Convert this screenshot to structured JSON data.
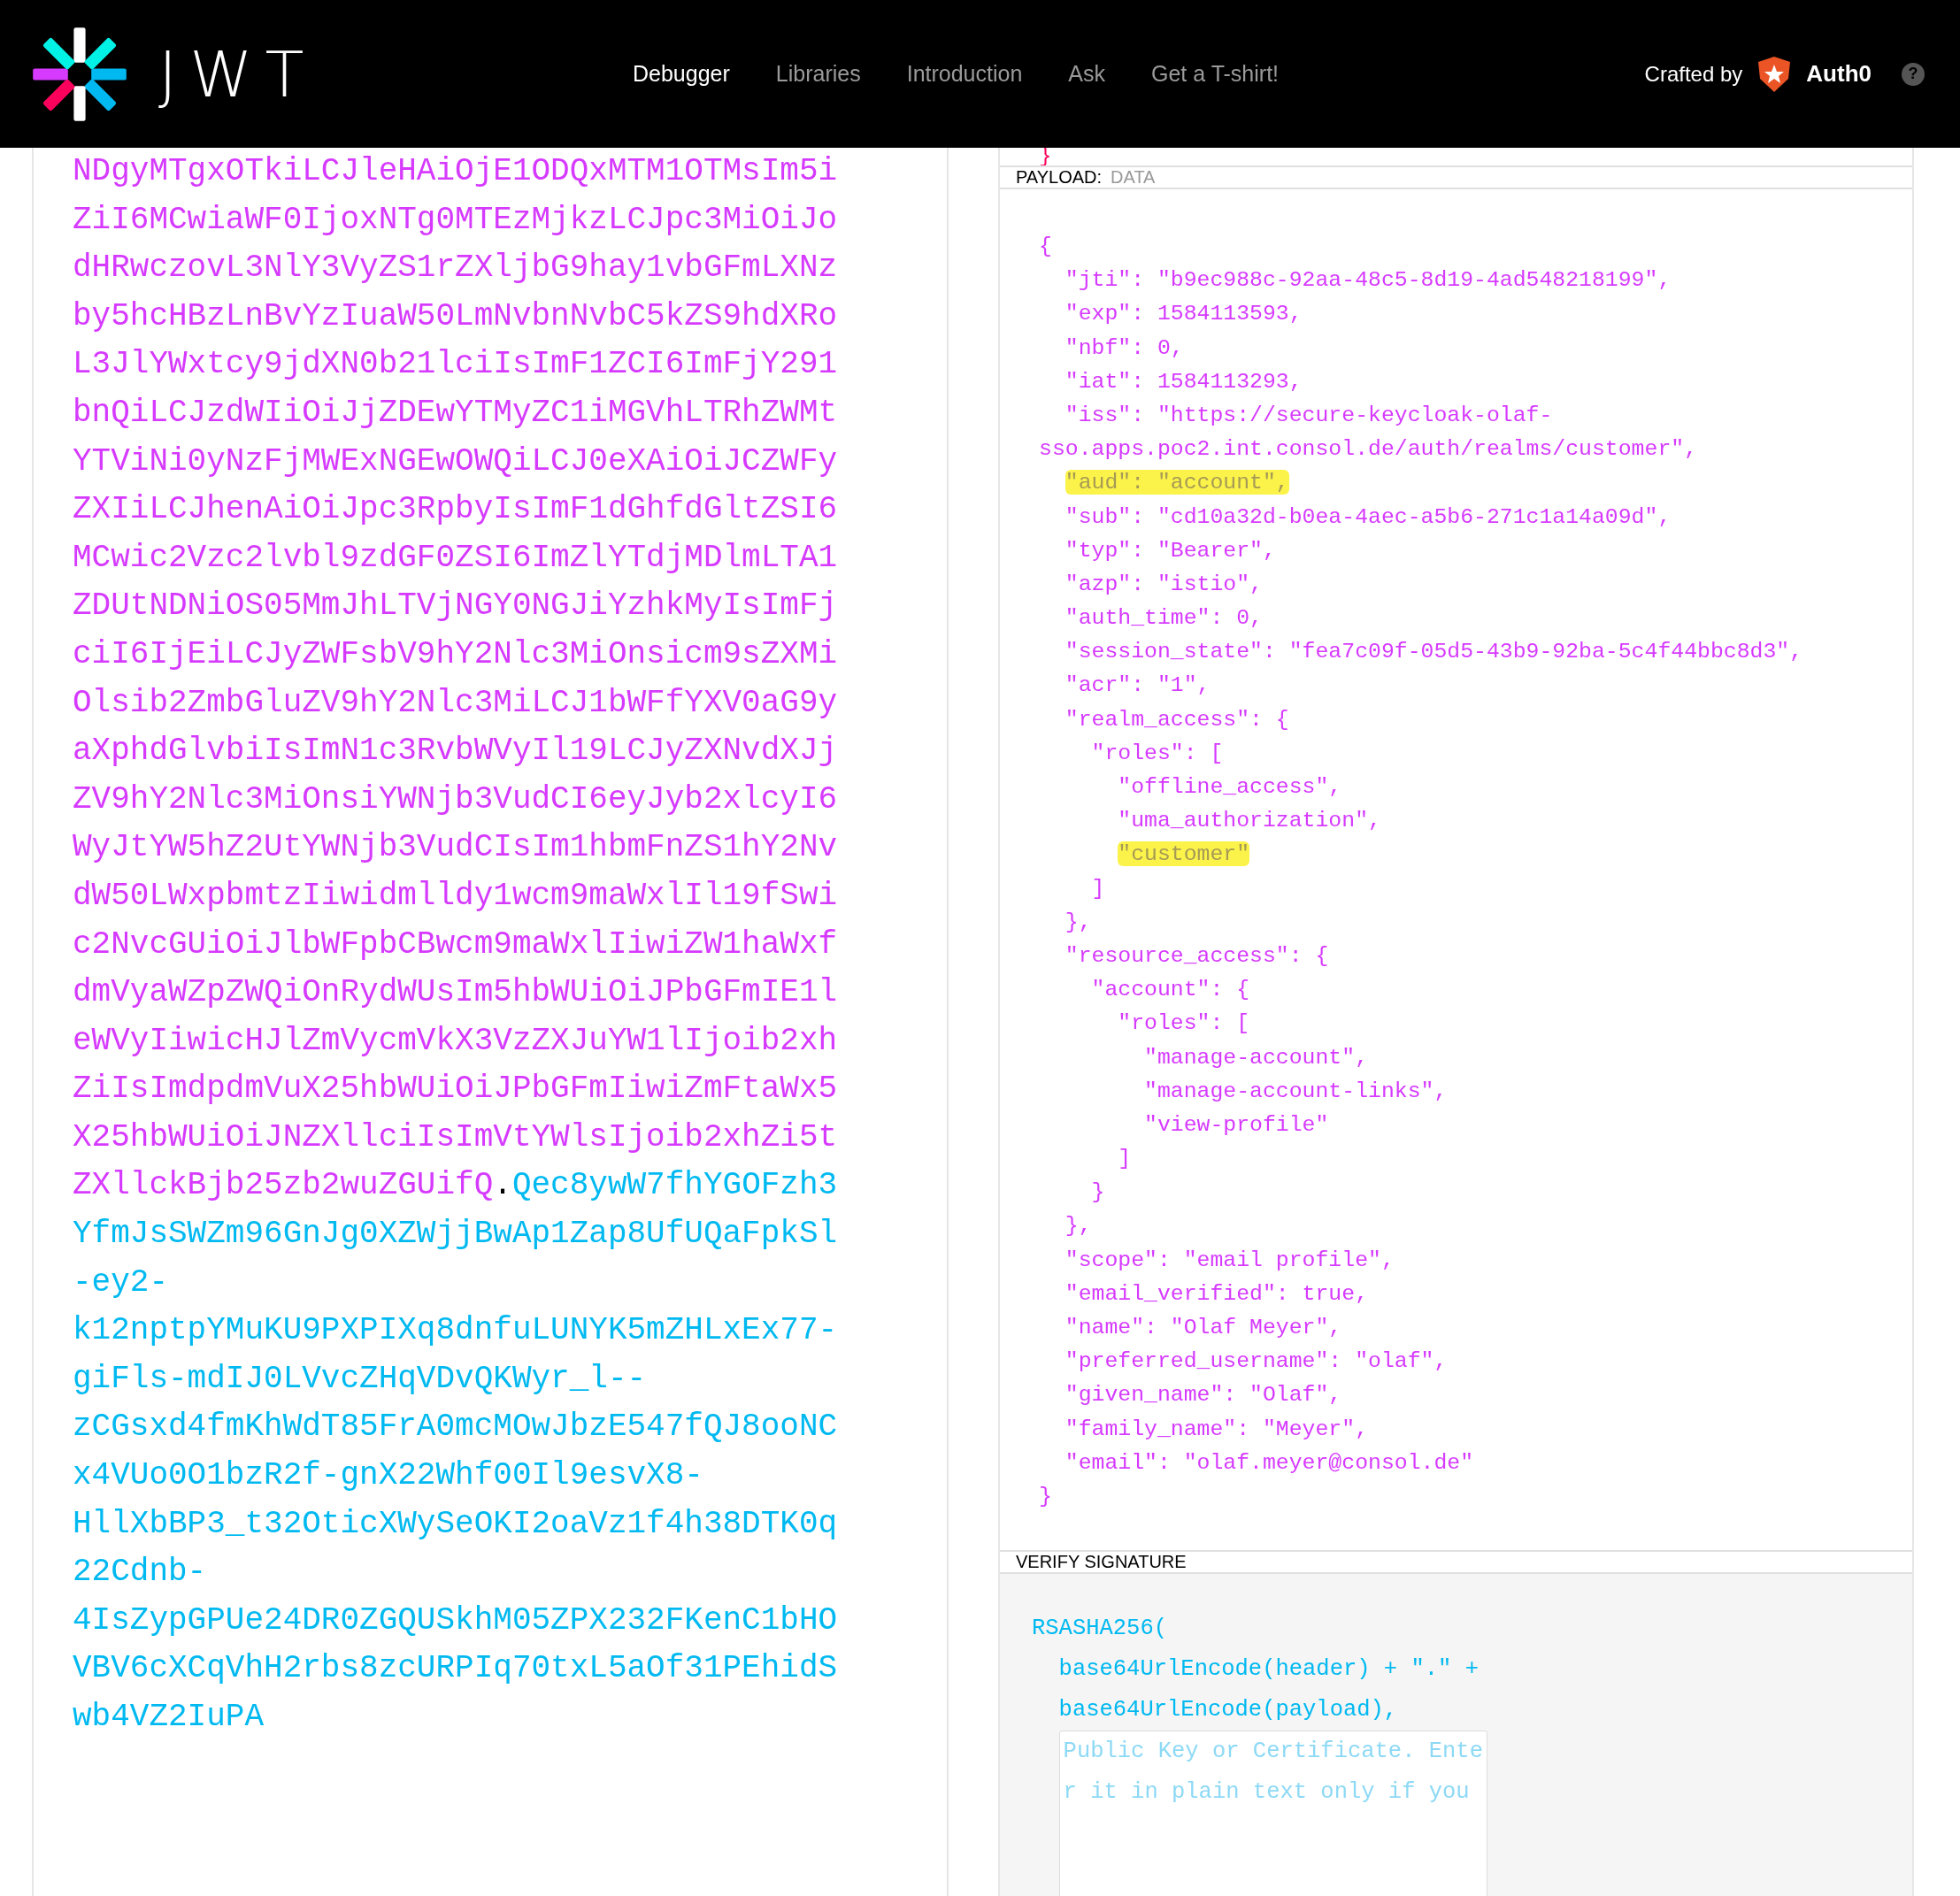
{
  "nav": {
    "logo_text": "JWT",
    "items": [
      {
        "label": "Debugger",
        "selected": true
      },
      {
        "label": "Libraries",
        "selected": false
      },
      {
        "label": "Introduction",
        "selected": false
      },
      {
        "label": "Ask",
        "selected": false
      },
      {
        "label": "Get a T-shirt!",
        "selected": false
      }
    ],
    "credit": "Crafted by",
    "brand": "Auth0",
    "help": "?"
  },
  "encoded": {
    "lines": [
      {
        "segments": [
          {
            "kind": "payload",
            "text": "NDgyMTgxOTkiLCJleHAiOjE1ODQxMTM1OTMsIm5i"
          }
        ]
      },
      {
        "segments": [
          {
            "kind": "payload",
            "text": "ZiI6MCwiaWF0IjoxNTg0MTEzMjkzLCJpc3MiOiJo"
          }
        ]
      },
      {
        "segments": [
          {
            "kind": "payload",
            "text": "dHRwczovL3NlY3VyZS1rZXljbG9hay1vbGFmLXNz"
          }
        ]
      },
      {
        "segments": [
          {
            "kind": "payload",
            "text": "by5hcHBzLnBvYzIuaW50LmNvbnNvbC5kZS9hdXRo"
          }
        ]
      },
      {
        "segments": [
          {
            "kind": "payload",
            "text": "L3JlYWxtcy9jdXN0b21lciIsImF1ZCI6ImFjY291"
          }
        ]
      },
      {
        "segments": [
          {
            "kind": "payload",
            "text": "bnQiLCJzdWIiOiJjZDEwYTMyZC1iMGVhLTRhZWMt"
          }
        ]
      },
      {
        "segments": [
          {
            "kind": "payload",
            "text": "YTViNi0yNzFjMWExNGEwOWQiLCJ0eXAiOiJCZWFy"
          }
        ]
      },
      {
        "segments": [
          {
            "kind": "payload",
            "text": "ZXIiLCJhenAiOiJpc3RpbyIsImF1dGhfdGltZSI6"
          }
        ]
      },
      {
        "segments": [
          {
            "kind": "payload",
            "text": "MCwic2Vzc2lvbl9zdGF0ZSI6ImZlYTdjMDlmLTA1"
          }
        ]
      },
      {
        "segments": [
          {
            "kind": "payload",
            "text": "ZDUtNDNiOS05MmJhLTVjNGY0NGJiYzhkMyIsImFj"
          }
        ]
      },
      {
        "segments": [
          {
            "kind": "payload",
            "text": "ciI6IjEiLCJyZWFsbV9hY2Nlc3MiOnsicm9sZXMi"
          }
        ]
      },
      {
        "segments": [
          {
            "kind": "payload",
            "text": "Olsib2ZmbGluZV9hY2Nlc3MiLCJ1bWFfYXV0aG9y"
          }
        ]
      },
      {
        "segments": [
          {
            "kind": "payload",
            "text": "aXphdGlvbiIsImN1c3RvbWVyIl19LCJyZXNvdXJj"
          }
        ]
      },
      {
        "segments": [
          {
            "kind": "payload",
            "text": "ZV9hY2Nlc3MiOnsiYWNjb3VudCI6eyJyb2xlcyI6"
          }
        ]
      },
      {
        "segments": [
          {
            "kind": "payload",
            "text": "WyJtYW5hZ2UtYWNjb3VudCIsIm1hbmFnZS1hY2Nv"
          }
        ]
      },
      {
        "segments": [
          {
            "kind": "payload",
            "text": "dW50LWxpbmtzIiwidmlldy1wcm9maWxlIl19fSwi"
          }
        ]
      },
      {
        "segments": [
          {
            "kind": "payload",
            "text": "c2NvcGUiOiJlbWFpbCBwcm9maWxlIiwiZW1haWxf"
          }
        ]
      },
      {
        "segments": [
          {
            "kind": "payload",
            "text": "dmVyaWZpZWQiOnRydWUsIm5hbWUiOiJPbGFmIE1l"
          }
        ]
      },
      {
        "segments": [
          {
            "kind": "payload",
            "text": "eWVyIiwicHJlZmVycmVkX3VzZXJuYW1lIjoib2xh"
          }
        ]
      },
      {
        "segments": [
          {
            "kind": "payload",
            "text": "ZiIsImdpdmVuX25hbWUiOiJPbGFmIiwiZmFtaWx5"
          }
        ]
      },
      {
        "segments": [
          {
            "kind": "payload",
            "text": "X25hbWUiOiJNZXllciIsImVtYWlsIjoib2xhZi5t"
          }
        ]
      },
      {
        "segments": [
          {
            "kind": "payload",
            "text": "ZXllckBjb25zb2wuZGUifQ"
          },
          {
            "kind": "dot",
            "text": "."
          },
          {
            "kind": "signature",
            "text": "Qec8ywW7fhYGOFzh3"
          }
        ]
      },
      {
        "segments": [
          {
            "kind": "signature",
            "text": "YfmJsSWZm96GnJg0XZWjjBwAp1Zap8UfUQaFpkSl"
          }
        ]
      },
      {
        "segments": [
          {
            "kind": "signature",
            "text": "-ey2-"
          }
        ]
      },
      {
        "segments": [
          {
            "kind": "signature",
            "text": "k12nptpYMuKU9PXPIXq8dnfuLUNYK5mZHLxEx77-"
          }
        ]
      },
      {
        "segments": [
          {
            "kind": "signature",
            "text": "giFls-mdIJ0LVvcZHqVDvQKWyr_l--"
          }
        ]
      },
      {
        "segments": [
          {
            "kind": "signature",
            "text": "zCGsxd4fmKhWdT85FrA0mcMOwJbzE547fQJ8ooNC"
          }
        ]
      },
      {
        "segments": [
          {
            "kind": "signature",
            "text": "x4VUo0O1bzR2f-gnX22Whf00Il9esvX8-"
          }
        ]
      },
      {
        "segments": [
          {
            "kind": "signature",
            "text": "HllXbBP3_t32OticXWySeOKI2oaVz1f4h38DTK0q"
          }
        ]
      },
      {
        "segments": [
          {
            "kind": "signature",
            "text": "22Cdnb-"
          }
        ]
      },
      {
        "segments": [
          {
            "kind": "signature",
            "text": "4IsZypGPUe24DR0ZGQUSkhM05ZPX232FKenC1bHO"
          }
        ]
      },
      {
        "segments": [
          {
            "kind": "signature",
            "text": "VBV6cXCqVhH2rbs8zcURPIq70txL5aOf31PEhidS"
          }
        ]
      },
      {
        "segments": [
          {
            "kind": "signature",
            "text": "wb4VZ2IuPA"
          }
        ]
      }
    ]
  },
  "decoded": {
    "header_tail": "}",
    "payload": {
      "title": "PAYLOAD:",
      "subtitle": "DATA",
      "lines": [
        {
          "text": "{",
          "highlighted": false
        },
        {
          "text": "  \"jti\": \"b9ec988c-92aa-48c5-8d19-4ad548218199\",",
          "highlighted": false
        },
        {
          "text": "  \"exp\": 1584113593,",
          "highlighted": false
        },
        {
          "text": "  \"nbf\": 0,",
          "highlighted": false
        },
        {
          "text": "  \"iat\": 1584113293,",
          "highlighted": false
        },
        {
          "text": "  \"iss\": \"https://secure-keycloak-olaf-",
          "highlighted": false
        },
        {
          "text": "sso.apps.poc2.int.consol.de/auth/realms/customer\",",
          "highlighted": false
        },
        {
          "text": "  \"aud\": \"account\",",
          "highlighted": true
        },
        {
          "text": "  \"sub\": \"cd10a32d-b0ea-4aec-a5b6-271c1a14a09d\",",
          "highlighted": false
        },
        {
          "text": "  \"typ\": \"Bearer\",",
          "highlighted": false
        },
        {
          "text": "  \"azp\": \"istio\",",
          "highlighted": false
        },
        {
          "text": "  \"auth_time\": 0,",
          "highlighted": false
        },
        {
          "text": "  \"session_state\": \"fea7c09f-05d5-43b9-92ba-5c4f44bbc8d3\",",
          "highlighted": false
        },
        {
          "text": "  \"acr\": \"1\",",
          "highlighted": false
        },
        {
          "text": "  \"realm_access\": {",
          "highlighted": false
        },
        {
          "text": "    \"roles\": [",
          "highlighted": false
        },
        {
          "text": "      \"offline_access\",",
          "highlighted": false
        },
        {
          "text": "      \"uma_authorization\",",
          "highlighted": false
        },
        {
          "text": "      \"customer\"",
          "highlighted": true
        },
        {
          "text": "    ]",
          "highlighted": false
        },
        {
          "text": "  },",
          "highlighted": false
        },
        {
          "text": "  \"resource_access\": {",
          "highlighted": false
        },
        {
          "text": "    \"account\": {",
          "highlighted": false
        },
        {
          "text": "      \"roles\": [",
          "highlighted": false
        },
        {
          "text": "        \"manage-account\",",
          "highlighted": false
        },
        {
          "text": "        \"manage-account-links\",",
          "highlighted": false
        },
        {
          "text": "        \"view-profile\"",
          "highlighted": false
        },
        {
          "text": "      ]",
          "highlighted": false
        },
        {
          "text": "    }",
          "highlighted": false
        },
        {
          "text": "  },",
          "highlighted": false
        },
        {
          "text": "  \"scope\": \"email profile\",",
          "highlighted": false
        },
        {
          "text": "  \"email_verified\": true,",
          "highlighted": false
        },
        {
          "text": "  \"name\": \"Olaf Meyer\",",
          "highlighted": false
        },
        {
          "text": "  \"preferred_username\": \"olaf\",",
          "highlighted": false
        },
        {
          "text": "  \"given_name\": \"Olaf\",",
          "highlighted": false
        },
        {
          "text": "  \"family_name\": \"Meyer\",",
          "highlighted": false
        },
        {
          "text": "  \"email\": \"olaf.meyer@consol.de\"",
          "highlighted": false
        },
        {
          "text": "}",
          "highlighted": false
        }
      ]
    },
    "verify": {
      "title": "VERIFY SIGNATURE",
      "lines": [
        "RSASHA256(",
        "  base64UrlEncode(header) + \".\" +",
        "  base64UrlEncode(payload),"
      ],
      "key_field": {
        "placeholder": "Public Key or Certificate. Enter it in plain text only if you"
      }
    }
  }
}
